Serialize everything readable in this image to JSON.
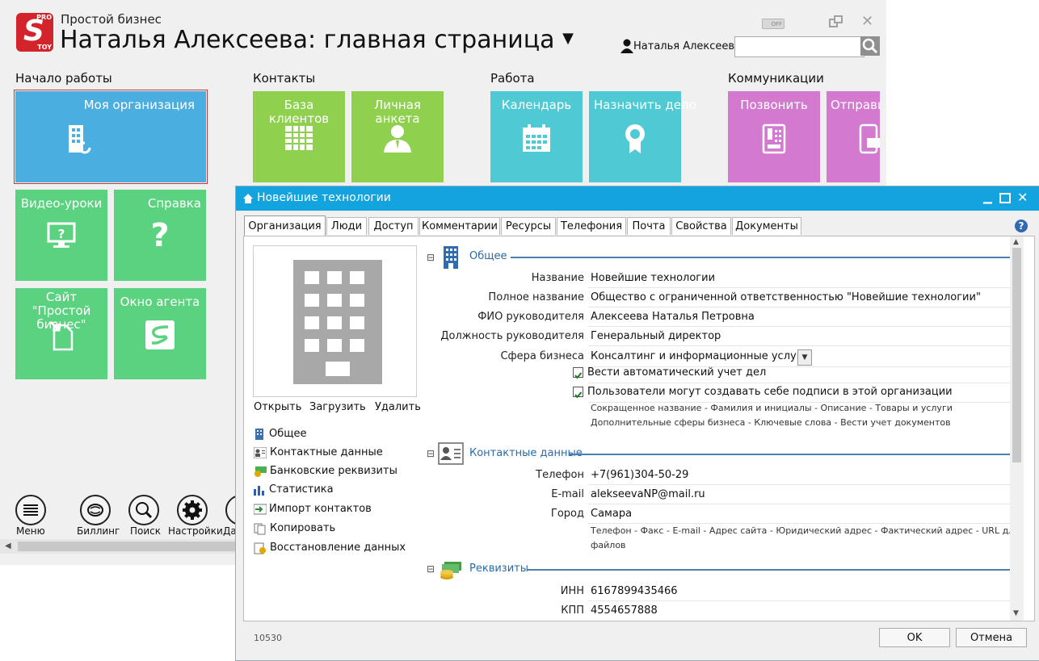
{
  "app": {
    "logo_top": "PRO",
    "logo_bottom": "TOY",
    "logo_letter": "S",
    "subtitle": "Простой бизнес",
    "title": "Наталья Алексеева: главная страница",
    "user_name": "Наталья Алексеева",
    "search_placeholder": ""
  },
  "sections": {
    "start": "Начало работы",
    "contacts": "Контакты",
    "work": "Работа",
    "comms": "Коммуникации"
  },
  "tiles": {
    "my_org": "Моя организация",
    "video": "Видео-уроки",
    "help": "Справка",
    "site": "Сайт \"Простой бизнес\"",
    "agent": "Окно агента",
    "clients": "База клиентов",
    "profile": "Личная анкета",
    "calendar": "Календарь",
    "assign": "Назначить дело",
    "call": "Позвонить",
    "send": "Отправить"
  },
  "bottom": {
    "menu": "Меню",
    "billing": "Биллинг",
    "search": "Поиск",
    "settings": "Настройки",
    "more": "Да"
  },
  "dialog": {
    "title": "Новейшие технологии",
    "tabs": [
      "Организация",
      "Люди",
      "Доступ",
      "Комментарии",
      "Ресурсы",
      "Телефония",
      "Почта",
      "Свойства",
      "Документы"
    ],
    "photo_actions": {
      "open": "Открыть",
      "upload": "Загрузить",
      "delete": "Удалить"
    },
    "nav": [
      "Общее",
      "Контактные данные",
      "Банковские реквизиты",
      "Статистика",
      "Импорт контактов",
      "Копировать",
      "Восстановление данных"
    ],
    "general": {
      "title": "Общее",
      "fields": [
        {
          "label": "Название",
          "value": "Новейшие технологии"
        },
        {
          "label": "Полное название",
          "value": "Общество с ограниченной ответственностью \"Новейшие технологии\""
        },
        {
          "label": "ФИО руководителя",
          "value": "Алексеева Наталья Петровна"
        },
        {
          "label": "Должность руководителя",
          "value": "Генеральный директор"
        },
        {
          "label": "Сфера бизнеса",
          "value": "Консалтинг и информационные услуги"
        }
      ],
      "checks": [
        {
          "label": "Вести автоматический учет дел",
          "checked": true
        },
        {
          "label": "Пользователи могут создавать себе подписи в этой организации",
          "checked": true
        }
      ],
      "links1": "Сокращенное название - Фамилия и инициалы - Описание - Товары и услуги",
      "links2": "Дополнительные сферы бизнеса - Ключевые слова - Вести учет документов"
    },
    "contacts": {
      "title": "Контактные данные",
      "fields": [
        {
          "label": "Телефон",
          "value": "+7(961)304-50-29"
        },
        {
          "label": "E-mail",
          "value": "alekseevaNP@mail.ru"
        },
        {
          "label": "Город",
          "value": "Самара"
        }
      ],
      "links1": "Телефон - Факс - E-mail - Адрес сайта - Юридический адрес - Фактический адрес - URL для",
      "links2": "файлов"
    },
    "requisites": {
      "title": "Реквизиты",
      "fields": [
        {
          "label": "ИНН",
          "value": "6167899435466"
        },
        {
          "label": "КПП",
          "value": "4554657888"
        }
      ]
    },
    "record_id": "10530",
    "ok": "OK",
    "cancel": "Отмена"
  },
  "colors": {
    "accent": "#13a3df",
    "blue_tile": "#4aaee0",
    "green_tile": "#5bd27f",
    "lime_tile": "#8fd04f",
    "cyan_tile": "#4fc9d4",
    "pink_tile": "#d37ad0"
  }
}
